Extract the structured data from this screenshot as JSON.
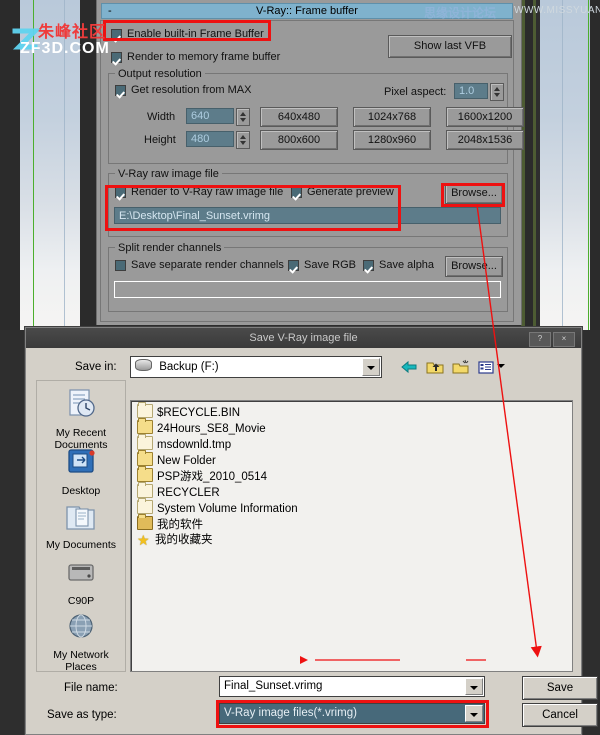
{
  "watermarks": {
    "left_zh": "朱峰社区",
    "left_en": "ZF3D.COM",
    "top_zh": "思缘设计论坛",
    "top_en": "WWW.MISSYUAN.COM"
  },
  "vray_panel": {
    "title": "V-Ray:: Frame buffer",
    "collapse_marker": "-",
    "enable_frame_buffer": {
      "label": "Enable built-in Frame Buffer",
      "checked": true,
      "highlighted": true
    },
    "render_to_memory": {
      "label": "Render to memory frame buffer",
      "checked": true
    },
    "show_last_vfb_button": "Show last VFB",
    "output_resolution": {
      "group_label": "Output resolution",
      "get_resolution_from_max": {
        "label": "Get resolution from MAX",
        "checked": true
      },
      "pixel_aspect_label": "Pixel aspect:",
      "pixel_aspect_value": "1.0",
      "width_label": "Width",
      "width_value": "640",
      "height_label": "Height",
      "height_value": "480",
      "presets": [
        "640x480",
        "1024x768",
        "1600x1200",
        "800x600",
        "1280x960",
        "2048x1536"
      ]
    },
    "raw_image_file": {
      "group_label": "V-Ray raw image file",
      "render_to_raw": {
        "label": "Render to V-Ray raw image file",
        "checked": true
      },
      "generate_preview": {
        "label": "Generate preview",
        "checked": true
      },
      "browse_button": "Browse...",
      "path_value": "E:\\Desktop\\Final_Sunset.vrimg"
    },
    "split_render_channels": {
      "group_label": "Split render channels",
      "save_separate": {
        "label": "Save separate render channels",
        "checked": false
      },
      "save_rgb": {
        "label": "Save RGB",
        "checked": true
      },
      "save_alpha": {
        "label": "Save alpha",
        "checked": true
      },
      "browse_button": "Browse...",
      "path_value": ""
    }
  },
  "save_dialog": {
    "title": "Save V-Ray image file",
    "help_button": "?",
    "close_button": "×",
    "save_in_label": "Save in:",
    "save_in_value": "Backup (F:)",
    "toolbar_icons": [
      "back-arrow-icon",
      "up-folder-icon",
      "new-folder-icon",
      "view-mode-icon"
    ],
    "places": [
      {
        "label": "My Recent Documents",
        "icon": "recent-documents-icon"
      },
      {
        "label": "Desktop",
        "icon": "desktop-icon"
      },
      {
        "label": "My Documents",
        "icon": "my-documents-icon"
      },
      {
        "label": "C90P",
        "icon": "hard-drive-icon"
      },
      {
        "label": "My Network Places",
        "icon": "network-places-icon"
      }
    ],
    "files": [
      {
        "name": "$RECYCLE.BIN",
        "icon": "folder-pale-icon"
      },
      {
        "name": "24Hours_SE8_Movie",
        "icon": "folder-icon"
      },
      {
        "name": "msdownld.tmp",
        "icon": "folder-pale-icon"
      },
      {
        "name": "New Folder",
        "icon": "folder-icon"
      },
      {
        "name": "PSP游戏_2010_0514",
        "icon": "folder-icon"
      },
      {
        "name": "RECYCLER",
        "icon": "folder-pale-icon"
      },
      {
        "name": "System Volume Information",
        "icon": "folder-pale-icon"
      },
      {
        "name": "我的软件",
        "icon": "folder-shared-icon"
      },
      {
        "name": "我的收藏夹",
        "icon": "favorites-star-icon"
      }
    ],
    "file_name_label": "File name:",
    "file_name_value": "Final_Sunset.vrimg",
    "save_as_type_label": "Save as type:",
    "save_as_type_value": "V-Ray image files(*.vrimg)",
    "save_button": "Save",
    "cancel_button": "Cancel"
  },
  "annotations": {
    "accent_red": "#ee1111",
    "arrow_from": "browse-button",
    "arrow_to": "save-button"
  }
}
